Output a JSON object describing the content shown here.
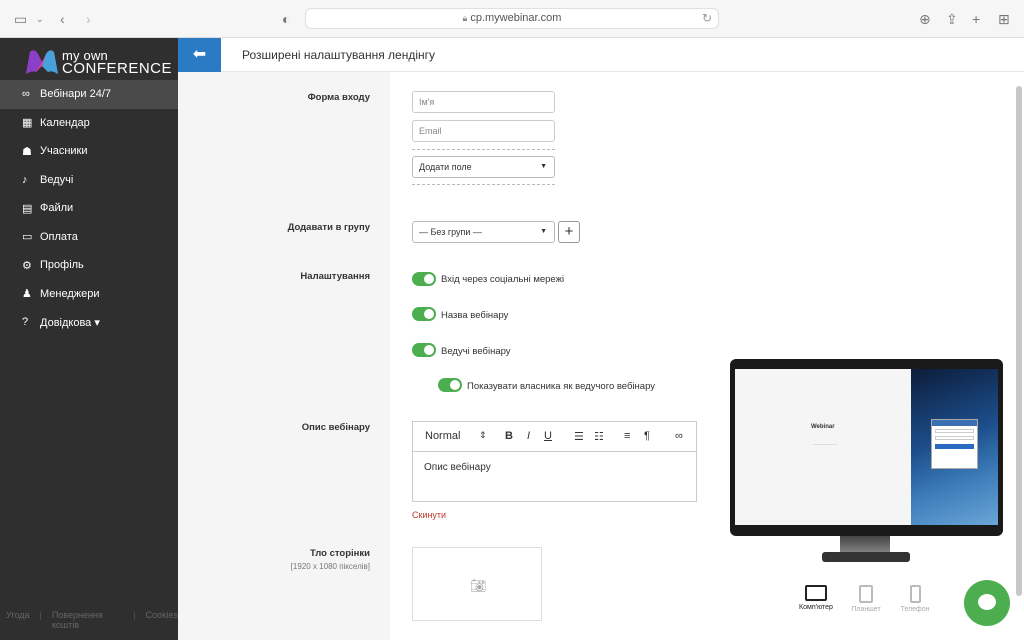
{
  "browser": {
    "url": "cp.mywebinar.com"
  },
  "logo": {
    "line1": "my own",
    "line2": "CONFERENCE"
  },
  "sidebar": {
    "items": [
      {
        "label": "Вебінари 24/7",
        "icon": "infinity-icon"
      },
      {
        "label": "Календар",
        "icon": "calendar-icon"
      },
      {
        "label": "Учасники",
        "icon": "users-icon"
      },
      {
        "label": "Ведучі",
        "icon": "microphone-icon"
      },
      {
        "label": "Файли",
        "icon": "folder-icon"
      },
      {
        "label": "Оплата",
        "icon": "credit-card-icon"
      },
      {
        "label": "Профіль",
        "icon": "gear-icon"
      },
      {
        "label": "Менеджери",
        "icon": "managers-icon"
      },
      {
        "label": "Довідкова ▾",
        "icon": "help-icon"
      }
    ],
    "footer": [
      "Угода",
      "Повернення коштів",
      "Cookies"
    ]
  },
  "header": {
    "title": "Розширені налаштування лендінгу"
  },
  "form": {
    "login_form_label": "Форма входу",
    "name_placeholder": "Ім'я",
    "email_placeholder": "Email",
    "add_field_label": "Додати поле",
    "add_to_group_label": "Додавати в групу",
    "group_selected": "— Без групи —",
    "settings_label": "Налаштування",
    "toggles": [
      {
        "label": "Вхід через соціальні мережі",
        "on": true
      },
      {
        "label": "Назва вебінару",
        "on": true
      },
      {
        "label": "Ведучі вебінару",
        "on": true
      },
      {
        "label": "Показувати власника як ведучого вебінару",
        "on": true
      }
    ],
    "description_label": "Опис вебінару",
    "editor_format": "Normal",
    "editor_text": "Опис вебінару",
    "reset_label": "Скинути",
    "background_label": "Тло сторінки",
    "background_hint": "[1920 x 1080 пікселів]"
  },
  "preview": {
    "screen_title": "Webinar",
    "devices": [
      {
        "label": "Комп'ютер",
        "active": true
      },
      {
        "label": "Планшет",
        "active": false
      },
      {
        "label": "Телефон",
        "active": false
      }
    ]
  },
  "colors": {
    "accent": "#2a7bc4",
    "toggle_on": "#4cae4f",
    "sidebar_bg": "#2f2f2f",
    "danger": "#c0392b"
  }
}
